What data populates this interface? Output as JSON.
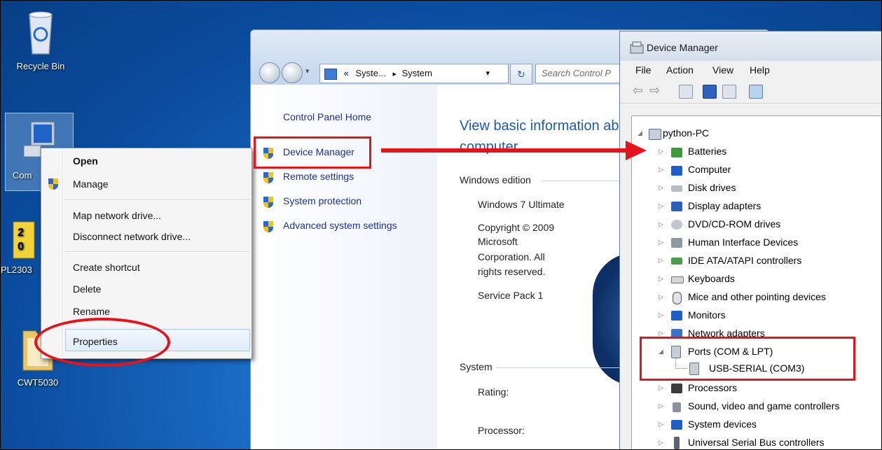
{
  "desktop": {
    "recycle_bin": "Recycle Bin",
    "computer": "Com",
    "pl2303": "PL2303",
    "cwt5030": "CWT5030"
  },
  "control_panel": {
    "address_sep": "«",
    "crumb1": "Syste...",
    "crumb_arrow": "▸",
    "crumb2": "System",
    "dropdown": "▾",
    "refresh": "↻",
    "search_placeholder": "Search Control P",
    "left_links": {
      "home": "Control Panel Home",
      "device_manager": "Device Manager",
      "remote": "Remote settings",
      "protection": "System protection",
      "advanced": "Advanced system settings"
    },
    "heading_line1": "View basic information ab",
    "heading_line2": "computer",
    "edition_section": "Windows edition",
    "edition": "Windows 7 Ultimate",
    "copyright_1": "Copyright © 2009",
    "copyright_2": "Microsoft",
    "copyright_3": "Corporation.  All",
    "copyright_4": "rights reserved.",
    "service_pack": "Service Pack 1",
    "system_section": "System",
    "rating_label": "Rating:",
    "processor_label": "Processor:"
  },
  "context_menu": {
    "open": "Open",
    "manage": "Manage",
    "map_drive": "Map network drive...",
    "disconnect_drive": "Disconnect network drive...",
    "create_shortcut": "Create shortcut",
    "delete": "Delete",
    "rename": "Rename",
    "properties": "Properties"
  },
  "device_manager": {
    "title": "Device Manager",
    "menu": [
      "File",
      "Action",
      "View",
      "Help"
    ],
    "root": "python-PC",
    "nodes": [
      "Batteries",
      "Computer",
      "Disk drives",
      "Display adapters",
      "DVD/CD-ROM drives",
      "Human Interface Devices",
      "IDE ATA/ATAPI controllers",
      "Keyboards",
      "Mice and other pointing devices",
      "Monitors",
      "Network adapters",
      "Ports (COM & LPT)",
      "USB-SERIAL (COM3)",
      "Processors",
      "Sound, video and game controllers",
      "System devices",
      "Universal Serial Bus controllers"
    ]
  },
  "colors": {
    "annotation_red": "#e3141c",
    "link_blue": "#1e3287",
    "heading_blue": "#1e5aa8"
  }
}
